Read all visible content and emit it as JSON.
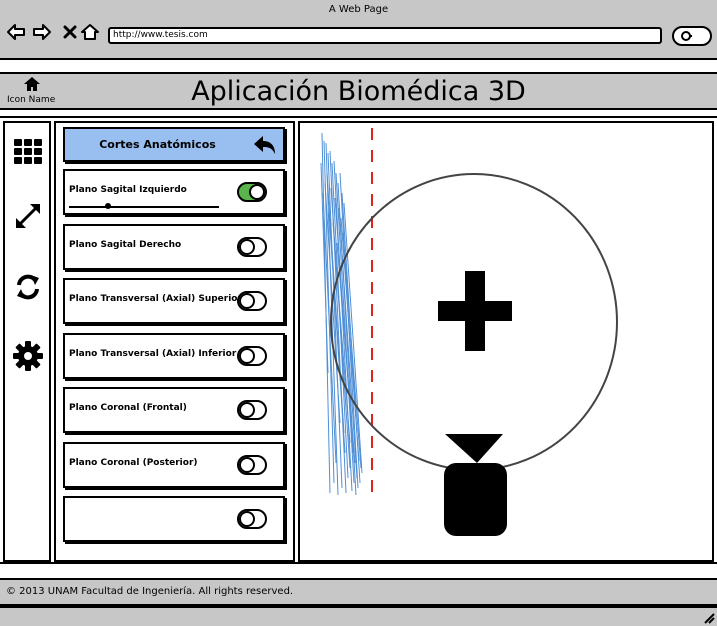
{
  "window": {
    "title": "A Web Page"
  },
  "browser": {
    "url": "http://www.tesis.com"
  },
  "header": {
    "icon_label": "Icon Name",
    "title": "Aplicación Biomédica 3D"
  },
  "rail": {
    "icons": [
      "grid-icon",
      "resize-diagonal-icon",
      "refresh-icon",
      "gear-icon"
    ]
  },
  "panel": {
    "title": "Cortes Anatómicos",
    "rows": [
      {
        "label": "Plano Sagital Izquierdo",
        "enabled": true,
        "slider_value": 0.26
      },
      {
        "label": "Plano Sagital Derecho",
        "enabled": false
      },
      {
        "label": "Plano Transversal (Axial) Superior",
        "enabled": false
      },
      {
        "label": "Plano Transversal (Axial) Inferior",
        "enabled": false
      },
      {
        "label": "Plano Coronal (Frontal)",
        "enabled": false
      },
      {
        "label": "Plano Coronal (Posterior)",
        "enabled": false
      },
      {
        "label": "",
        "enabled": false
      }
    ]
  },
  "colors": {
    "chrome_gray": "#c7c7c7",
    "panel_header_blue": "#99bff0",
    "toggle_on_green": "#5ab44b",
    "cut_plane_red": "#e0231c",
    "hatch_blue": "#4f8fd6"
  },
  "footer": {
    "text": "© 2013 UNAM Facultad de Ingeniería. All rights reserved."
  }
}
